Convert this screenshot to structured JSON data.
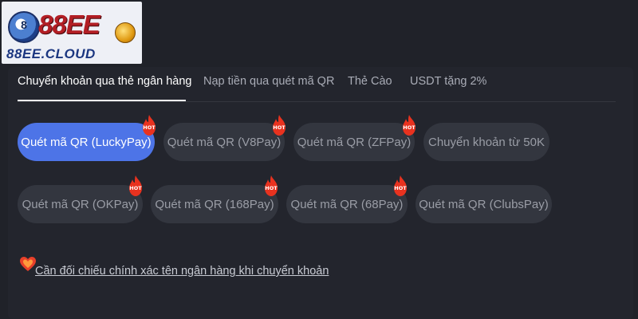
{
  "logo": {
    "name": "88EE",
    "domain": "88EE.CLOUD"
  },
  "tabs": [
    {
      "label": "Chuyển khoản qua thẻ ngân hàng",
      "active": true
    },
    {
      "label": "Nạp tiền qua quét mã QR",
      "active": false
    },
    {
      "label": "Thẻ Cào",
      "active": false
    },
    {
      "label": "USDT tặng 2%",
      "active": false
    }
  ],
  "methods": [
    {
      "label": "Quét mã QR (LuckyPay)",
      "hot": true,
      "selected": true
    },
    {
      "label": "Quét mã QR (V8Pay)",
      "hot": true,
      "selected": false
    },
    {
      "label": "Quét mã QR (ZFPay)",
      "hot": true,
      "selected": false
    },
    {
      "label": "Chuyển khoản từ 50K",
      "hot": false,
      "selected": false
    },
    {
      "label": "Quét mã QR (OKPay)",
      "hot": true,
      "selected": false
    },
    {
      "label": "Quét mã QR (168Pay)",
      "hot": true,
      "selected": false
    },
    {
      "label": "Quét mã QR (68Pay)",
      "hot": true,
      "selected": false
    },
    {
      "label": "Quét mã QR (ClubsPay)",
      "hot": false,
      "selected": false
    }
  ],
  "badge": {
    "hot_label": "HOT"
  },
  "notice": {
    "text": "Cần đối chiếu chính xác tên ngân hàng khi chuyển khoản",
    "icon": "heart-icon"
  },
  "colors": {
    "accent": "#4d74e7",
    "background": "#202229",
    "pill": "#33363f",
    "hot": "#e8321f"
  }
}
